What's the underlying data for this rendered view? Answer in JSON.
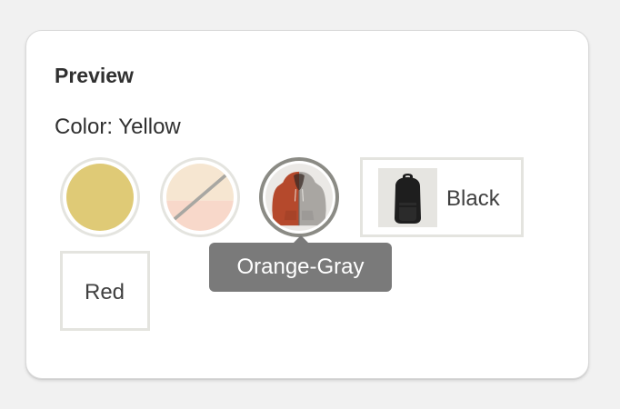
{
  "card": {
    "title": "Preview",
    "color_prefix": "Color:",
    "selected_color": "Yellow"
  },
  "swatches": [
    {
      "name": "Yellow",
      "type": "solid",
      "color": "#dfca76"
    },
    {
      "name": "Peach",
      "type": "split",
      "top_color": "#f6e6d1",
      "bottom_color": "#f8d8ca",
      "strike": true
    },
    {
      "name": "Orange-Gray",
      "type": "image",
      "image": "hoodie-image",
      "left_color": "#b5492c",
      "right_color": "#a9a6a2"
    }
  ],
  "tiles": [
    {
      "name": "Black",
      "label": "Black",
      "image": "backpack-image"
    },
    {
      "name": "Red",
      "label": "Red"
    }
  ],
  "tooltip": {
    "text": "Orange-Gray"
  }
}
